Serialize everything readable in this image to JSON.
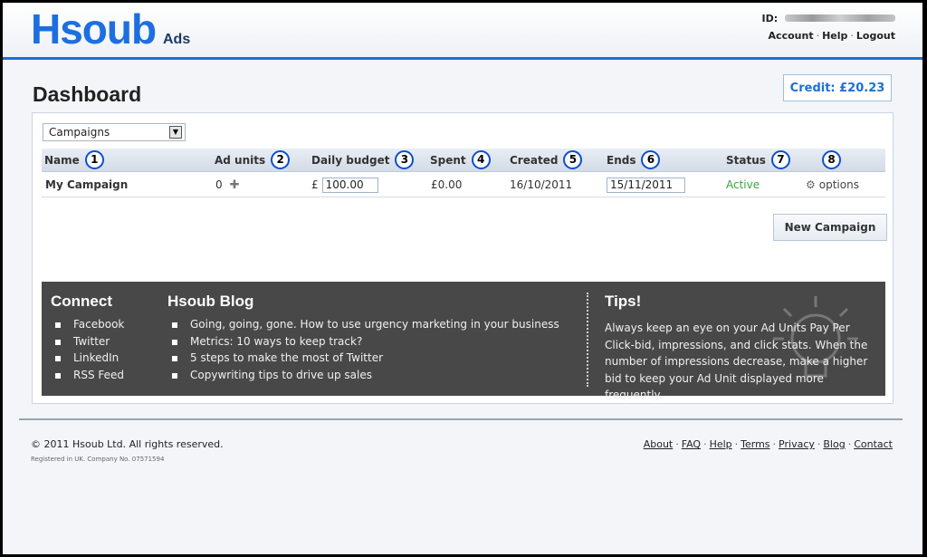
{
  "header": {
    "logo_main": "Hsoub",
    "logo_sub": "Ads",
    "id_label": "ID:",
    "account_links": [
      "Account",
      "Help",
      "Logout"
    ]
  },
  "page_title": "Dashboard",
  "credit": "Credit: £20.23",
  "campaign_select": {
    "selected": "Campaigns"
  },
  "table": {
    "columns": [
      {
        "label": "Name",
        "badge": "1"
      },
      {
        "label": "Ad units",
        "badge": "2"
      },
      {
        "label": "Daily budget",
        "badge": "3"
      },
      {
        "label": "Spent",
        "badge": "4"
      },
      {
        "label": "Created",
        "badge": "5"
      },
      {
        "label": "Ends",
        "badge": "6"
      },
      {
        "label": "Status",
        "badge": "7"
      },
      {
        "label": "",
        "badge": "8"
      }
    ],
    "row": {
      "name": "My Campaign",
      "ad_units": "0",
      "currency": "£",
      "daily_budget": "100.00",
      "spent": "£0.00",
      "created": "16/10/2011",
      "ends": "15/11/2011",
      "status": "Active",
      "options": "options"
    }
  },
  "new_campaign_label": "New Campaign",
  "info": {
    "connect_heading": "Connect",
    "connect_items": [
      "Facebook",
      "Twitter",
      "LinkedIn",
      "RSS Feed"
    ],
    "blog_heading": "Hsoub Blog",
    "blog_items": [
      "Going, going, gone. How to use urgency marketing in your business",
      "Metrics: 10 ways to keep track?",
      "5 steps to make the most of Twitter",
      "Copywriting tips to drive up sales"
    ],
    "tips_heading": "Tips!",
    "tips_text": "Always keep an eye on your Ad Units Pay Per Click-bid, impressions, and click stats. When the number of impressions decrease, make a higher bid to keep your Ad Unit displayed more frequently."
  },
  "footer": {
    "copyright": "© 2011 Hsoub Ltd. All rights reserved.",
    "registered": "Registered in UK. Company No. 07571594",
    "links": [
      "About",
      "FAQ",
      "Help",
      "Terms",
      "Privacy",
      "Blog",
      "Contact"
    ]
  },
  "colors": {
    "brand_blue": "#1d6fe0",
    "status_active": "#3aa53a",
    "badge_border": "#0b4fcf",
    "info_panel_bg": "#484848"
  }
}
